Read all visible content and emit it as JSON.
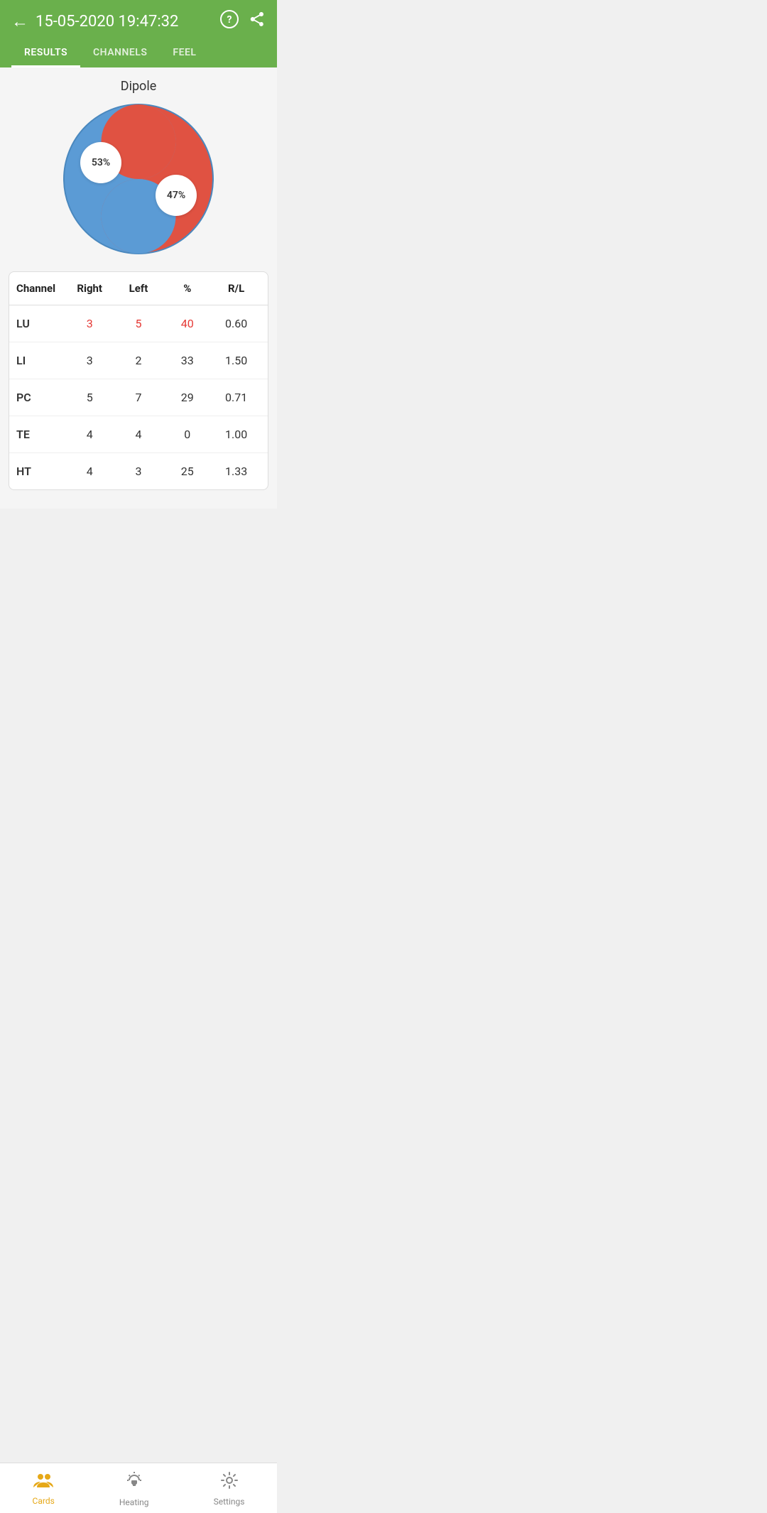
{
  "header": {
    "datetime": "15-05-2020 19:47:32",
    "back_label": "←",
    "help_icon": "?",
    "share_icon": "share"
  },
  "tabs": [
    {
      "label": "RESULTS",
      "active": true
    },
    {
      "label": "CHANNELS",
      "active": false
    },
    {
      "label": "FEEL",
      "active": false
    }
  ],
  "chart": {
    "title": "Dipole",
    "left_pct": "53%",
    "right_pct": "47%",
    "red_color": "#e05242",
    "blue_color": "#5b9bd5"
  },
  "table": {
    "headers": [
      "Channel",
      "Right",
      "Left",
      "%",
      "R/L"
    ],
    "rows": [
      {
        "channel": "LU",
        "right": "3",
        "left": "5",
        "pct": "40",
        "rl": "0.60",
        "highlight": true
      },
      {
        "channel": "LI",
        "right": "3",
        "left": "2",
        "pct": "33",
        "rl": "1.50",
        "highlight": false
      },
      {
        "channel": "PC",
        "right": "5",
        "left": "7",
        "pct": "29",
        "rl": "0.71",
        "highlight": false
      },
      {
        "channel": "TE",
        "right": "4",
        "left": "4",
        "pct": "0",
        "rl": "1.00",
        "highlight": false
      },
      {
        "channel": "HT",
        "right": "4",
        "left": "3",
        "pct": "25",
        "rl": "1.33",
        "highlight": false
      }
    ]
  },
  "bottom_nav": [
    {
      "label": "Cards",
      "icon": "👥",
      "active": true
    },
    {
      "label": "Heating",
      "icon": "🔆",
      "active": false
    },
    {
      "label": "Settings",
      "icon": "⚙",
      "active": false
    }
  ]
}
